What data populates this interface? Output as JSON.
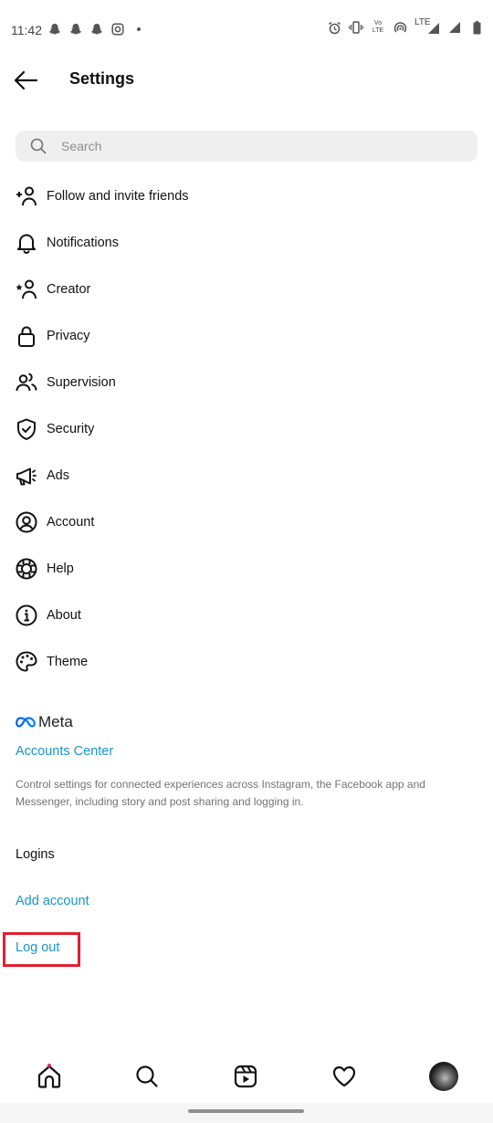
{
  "status_bar": {
    "time": "11:42",
    "left_icons": [
      "snapchat-icon",
      "snapchat-icon",
      "snapchat-icon",
      "instagram-icon",
      "dot-icon"
    ],
    "right_icons": [
      "alarm-icon",
      "vibrate-icon",
      "volte-icon",
      "hotspot-icon",
      "lte-signal-icon",
      "signal-icon",
      "battery-icon"
    ],
    "volte_label": "Vo LTE",
    "lte_label": "LTE"
  },
  "header": {
    "back_icon": "arrow-left-icon",
    "title": "Settings"
  },
  "search": {
    "placeholder": "Search",
    "value": ""
  },
  "menu": {
    "items": [
      {
        "label": "Follow and invite friends",
        "icon": "add-person-icon"
      },
      {
        "label": "Notifications",
        "icon": "bell-icon"
      },
      {
        "label": "Creator",
        "icon": "star-person-icon"
      },
      {
        "label": "Privacy",
        "icon": "lock-icon"
      },
      {
        "label": "Supervision",
        "icon": "people-icon"
      },
      {
        "label": "Security",
        "icon": "shield-check-icon"
      },
      {
        "label": "Ads",
        "icon": "megaphone-icon"
      },
      {
        "label": "Account",
        "icon": "user-circle-icon"
      },
      {
        "label": "Help",
        "icon": "lifebuoy-icon"
      },
      {
        "label": "About",
        "icon": "info-icon"
      },
      {
        "label": "Theme",
        "icon": "palette-icon"
      }
    ]
  },
  "meta": {
    "logo_text": "Meta",
    "accounts_center": "Accounts Center",
    "description": "Control settings for connected experiences across Instagram, the Facebook app and Messenger, including story and post sharing and logging in."
  },
  "logins": {
    "heading": "Logins",
    "add_account": "Add account",
    "log_out": "Log out",
    "highlight_color": "#e0202f"
  },
  "bottom_nav": {
    "items": [
      "home-icon",
      "search-icon",
      "reels-icon",
      "heart-icon",
      "profile-avatar"
    ],
    "active": "home-icon"
  },
  "colors": {
    "link": "#1a95c9",
    "text": "#111111",
    "secondary_text": "#737373",
    "search_bg": "#efefef"
  }
}
